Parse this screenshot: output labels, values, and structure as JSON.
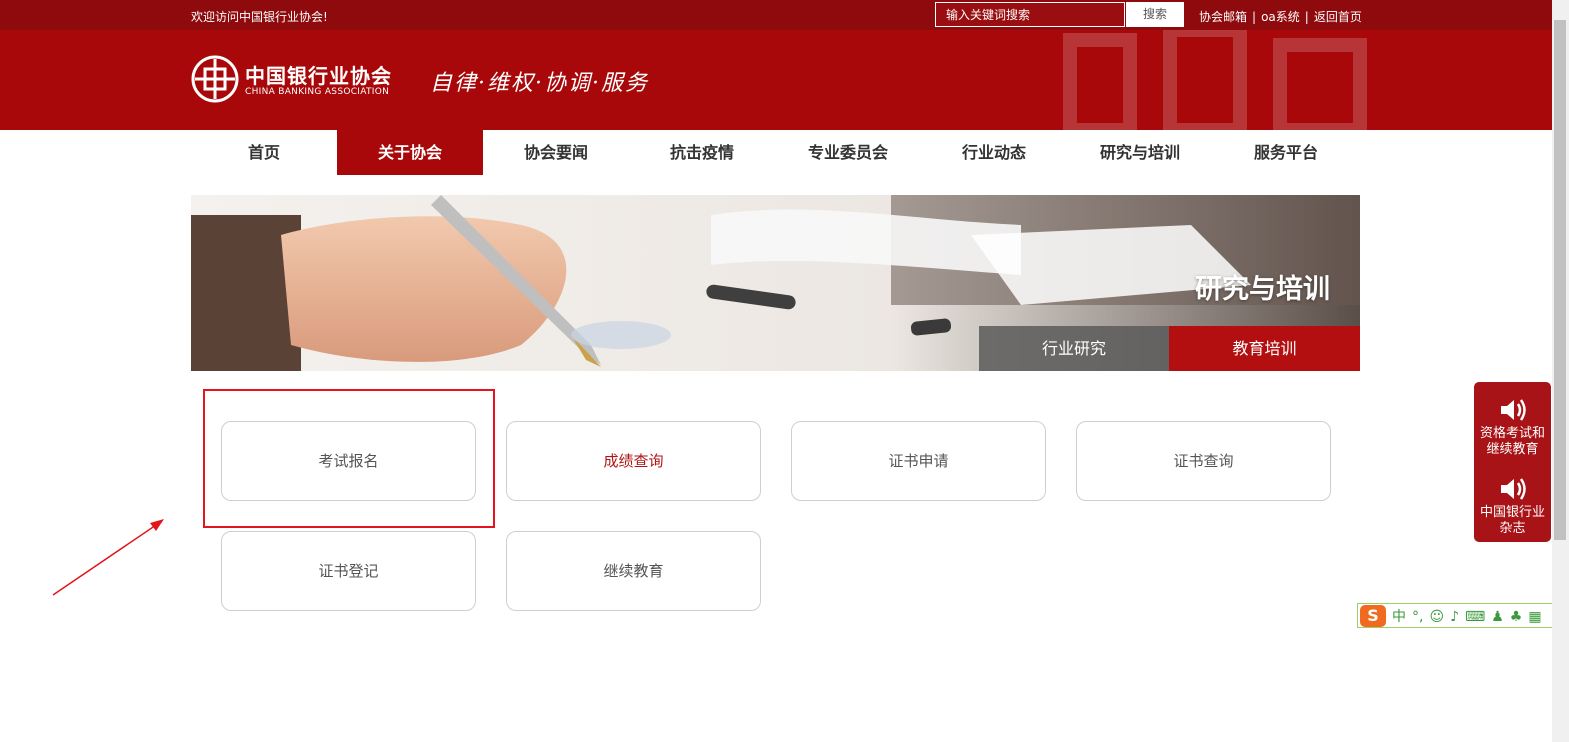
{
  "topbar": {
    "welcome": "欢迎访问中国银行业协会!",
    "search_placeholder": "输入关键词搜索",
    "search_button": "搜索",
    "links": [
      "协会邮箱",
      "oa系统",
      "返回首页"
    ],
    "separator": "|"
  },
  "header": {
    "logo_cn": "中国银行业协会",
    "logo_en": "CHINA BANKING ASSOCIATION",
    "slogan": "自律·维权·协调·服务"
  },
  "nav": {
    "items": [
      "首页",
      "关于协会",
      "协会要闻",
      "抗击疫情",
      "专业委员会",
      "行业动态",
      "研究与培训",
      "服务平台"
    ],
    "active_index": 1
  },
  "banner": {
    "title": "研究与培训",
    "tabs": [
      "行业研究",
      "教育培训"
    ],
    "active_tab": 1
  },
  "cards": [
    "考试报名",
    "成绩查询",
    "证书申请",
    "证书查询",
    "证书登记",
    "继续教育"
  ],
  "side_float": {
    "items": [
      "资格考试和继续教育",
      "中国银行业杂志"
    ],
    "icon": "speaker-icon"
  },
  "ime": {
    "logo": "S",
    "mode": "中"
  },
  "colors": {
    "brand_red": "#a80809",
    "topbar": "#8e0a0d",
    "highlight": "#e3141b",
    "link_red": "#b01414"
  }
}
